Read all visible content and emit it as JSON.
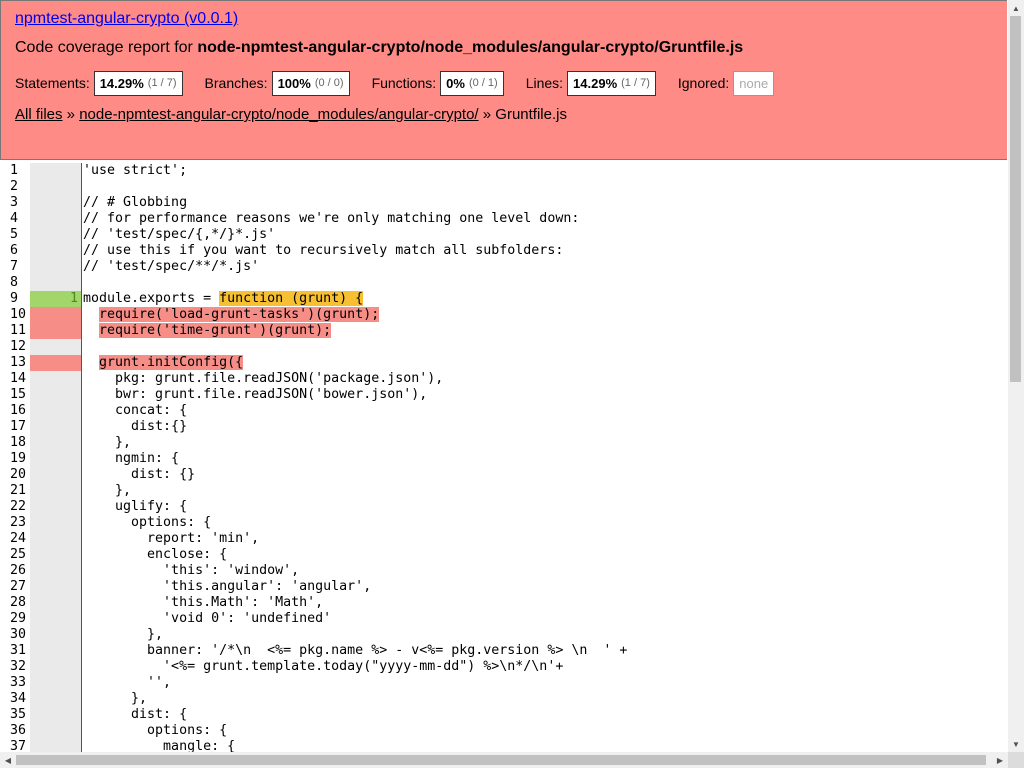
{
  "header": {
    "title": "npmtest-angular-crypto (v0.0.1)",
    "subtitle_prefix": "Code coverage report for ",
    "subtitle_path": "node-npmtest-angular-crypto/node_modules/angular-crypto/Gruntfile.js"
  },
  "stats": [
    {
      "label": "Statements:",
      "pct": "14.29%",
      "frac": "(1 / 7)"
    },
    {
      "label": "Branches:",
      "pct": "100%",
      "frac": "(0 / 0)"
    },
    {
      "label": "Functions:",
      "pct": "0%",
      "frac": "(0 / 1)"
    },
    {
      "label": "Lines:",
      "pct": "14.29%",
      "frac": "(1 / 7)"
    }
  ],
  "ignored": {
    "label": "Ignored:",
    "value": "none"
  },
  "breadcrumb": {
    "all_files": "All files",
    "sep": " » ",
    "folder": "node-npmtest-angular-crypto/node_modules/angular-crypto/",
    "file": "Gruntfile.js"
  },
  "code_lines": [
    {
      "n": "1",
      "count": "",
      "status": "",
      "text": "'use strict';"
    },
    {
      "n": "2",
      "count": "",
      "status": "",
      "text": ""
    },
    {
      "n": "3",
      "count": "",
      "status": "",
      "text": "// # Globbing"
    },
    {
      "n": "4",
      "count": "",
      "status": "",
      "text": "// for performance reasons we're only matching one level down:"
    },
    {
      "n": "5",
      "count": "",
      "status": "",
      "text": "// 'test/spec/{,*/}*.js'"
    },
    {
      "n": "6",
      "count": "",
      "status": "",
      "text": "// use this if you want to recursively match all subfolders:"
    },
    {
      "n": "7",
      "count": "",
      "status": "",
      "text": "// 'test/spec/**/*.js'"
    },
    {
      "n": "8",
      "count": "",
      "status": "",
      "text": ""
    },
    {
      "n": "9",
      "count": "1",
      "status": "hit",
      "pre": "module.exports = ",
      "hl": "function (grunt) {",
      "hlclass": "fn"
    },
    {
      "n": "10",
      "count": "",
      "status": "miss",
      "pre": "  ",
      "hl": "require('load-grunt-tasks')(grunt);",
      "hlclass": "miss"
    },
    {
      "n": "11",
      "count": "",
      "status": "miss",
      "pre": "  ",
      "hl": "require('time-grunt')(grunt);",
      "hlclass": "miss"
    },
    {
      "n": "12",
      "count": "",
      "status": "",
      "text": ""
    },
    {
      "n": "13",
      "count": "",
      "status": "miss",
      "pre": "  ",
      "hl": "grunt.initConfig({",
      "hlclass": "miss"
    },
    {
      "n": "14",
      "count": "",
      "status": "",
      "text": "    pkg: grunt.file.readJSON('package.json'),"
    },
    {
      "n": "15",
      "count": "",
      "status": "",
      "text": "    bwr: grunt.file.readJSON('bower.json'),"
    },
    {
      "n": "16",
      "count": "",
      "status": "",
      "text": "    concat: {"
    },
    {
      "n": "17",
      "count": "",
      "status": "",
      "text": "      dist:{}"
    },
    {
      "n": "18",
      "count": "",
      "status": "",
      "text": "    },"
    },
    {
      "n": "19",
      "count": "",
      "status": "",
      "text": "    ngmin: {"
    },
    {
      "n": "20",
      "count": "",
      "status": "",
      "text": "      dist: {}"
    },
    {
      "n": "21",
      "count": "",
      "status": "",
      "text": "    },"
    },
    {
      "n": "22",
      "count": "",
      "status": "",
      "text": "    uglify: {"
    },
    {
      "n": "23",
      "count": "",
      "status": "",
      "text": "      options: {"
    },
    {
      "n": "24",
      "count": "",
      "status": "",
      "text": "        report: 'min',"
    },
    {
      "n": "25",
      "count": "",
      "status": "",
      "text": "        enclose: {"
    },
    {
      "n": "26",
      "count": "",
      "status": "",
      "text": "          'this': 'window',"
    },
    {
      "n": "27",
      "count": "",
      "status": "",
      "text": "          'this.angular': 'angular',"
    },
    {
      "n": "28",
      "count": "",
      "status": "",
      "text": "          'this.Math': 'Math',"
    },
    {
      "n": "29",
      "count": "",
      "status": "",
      "text": "          'void 0': 'undefined'"
    },
    {
      "n": "30",
      "count": "",
      "status": "",
      "text": "        },"
    },
    {
      "n": "31",
      "count": "",
      "status": "",
      "text": "        banner: '/*\\n  <%= pkg.name %> - v<%= pkg.version %> \\n  ' +"
    },
    {
      "n": "32",
      "count": "",
      "status": "",
      "text": "          '<%= grunt.template.today(\"yyyy-mm-dd\") %>\\n*/\\n'+"
    },
    {
      "n": "33",
      "count": "",
      "status": "",
      "text": "        '',"
    },
    {
      "n": "34",
      "count": "",
      "status": "",
      "text": "      },"
    },
    {
      "n": "35",
      "count": "",
      "status": "",
      "text": "      dist: {"
    },
    {
      "n": "36",
      "count": "",
      "status": "",
      "text": "        options: {"
    },
    {
      "n": "37",
      "count": "",
      "status": "",
      "text": "          mangle: {"
    }
  ]
}
